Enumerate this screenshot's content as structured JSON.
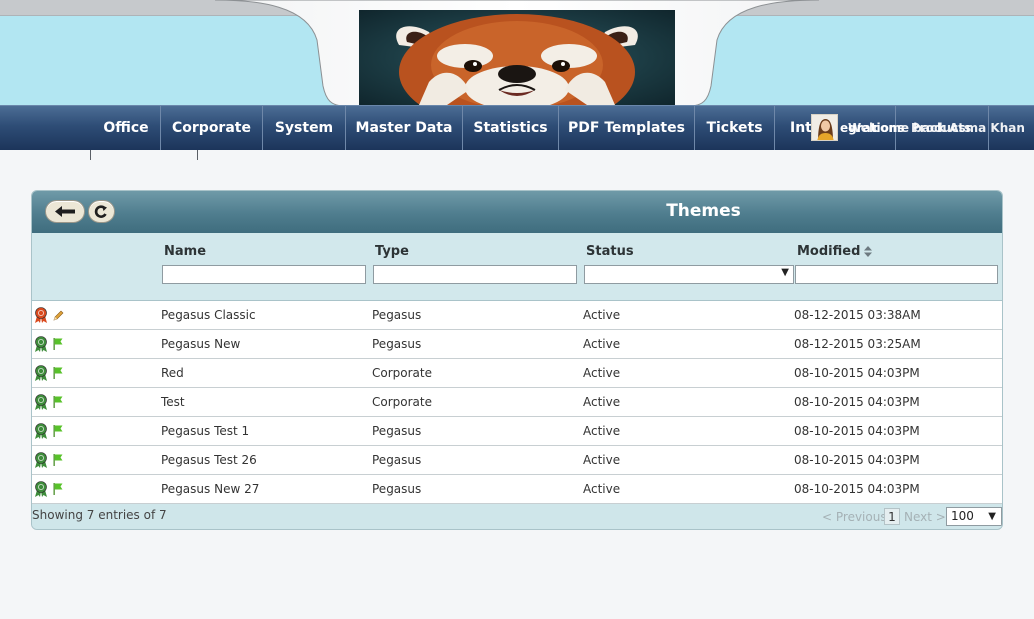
{
  "nav": {
    "items": [
      {
        "label": "Office"
      },
      {
        "label": "Corporate"
      },
      {
        "label": "System"
      },
      {
        "label": "Master Data"
      },
      {
        "label": "Statistics"
      },
      {
        "label": "PDF Templates"
      },
      {
        "label": "Tickets"
      },
      {
        "label": "Int"
      }
    ],
    "overlay_label": "egrations",
    "welcome_text": "Welcome back Asma Khan",
    "products_label": "Products",
    "avatar_icon": "user-avatar-icon"
  },
  "panel": {
    "title": "Themes",
    "back_icon": "arrow-left-icon",
    "refresh_icon": "refresh-icon",
    "columns": {
      "name": "Name",
      "type": "Type",
      "status": "Status",
      "modified": "Modified"
    },
    "filters": {
      "name": "",
      "type": "",
      "status": "",
      "modified": ""
    }
  },
  "rows": [
    {
      "name": "Pegasus Classic",
      "type": "Pegasus",
      "status": "Active",
      "modified": "08-12-2015 03:38AM",
      "ribbon_color": "#d94a1e",
      "action_icon": "pencil-icon"
    },
    {
      "name": "Pegasus New",
      "type": "Pegasus",
      "status": "Active",
      "modified": "08-12-2015 03:25AM",
      "ribbon_color": "#3e8c3b",
      "action_icon": "flag-icon"
    },
    {
      "name": "Red",
      "type": "Corporate",
      "status": "Active",
      "modified": "08-10-2015 04:03PM",
      "ribbon_color": "#3e8c3b",
      "action_icon": "flag-icon"
    },
    {
      "name": "Test",
      "type": "Corporate",
      "status": "Active",
      "modified": "08-10-2015 04:03PM",
      "ribbon_color": "#3e8c3b",
      "action_icon": "flag-icon"
    },
    {
      "name": "Pegasus Test 1",
      "type": "Pegasus",
      "status": "Active",
      "modified": "08-10-2015 04:03PM",
      "ribbon_color": "#3e8c3b",
      "action_icon": "flag-icon"
    },
    {
      "name": "Pegasus Test 26",
      "type": "Pegasus",
      "status": "Active",
      "modified": "08-10-2015 04:03PM",
      "ribbon_color": "#3e8c3b",
      "action_icon": "flag-icon"
    },
    {
      "name": "Pegasus New 27",
      "type": "Pegasus",
      "status": "Active",
      "modified": "08-10-2015 04:03PM",
      "ribbon_color": "#3e8c3b",
      "action_icon": "flag-icon"
    }
  ],
  "footer": {
    "showing_text": "Showing 7 entries of 7",
    "previous_label": "< Previous",
    "current_page": "1",
    "next_label": "Next >",
    "page_size": "100"
  },
  "colors": {
    "header_bg": "#b2e6f2",
    "nav_bg": "#2e4d76",
    "panel_head": "#4f7d8e",
    "panel_bg": "#cfe6ea"
  }
}
